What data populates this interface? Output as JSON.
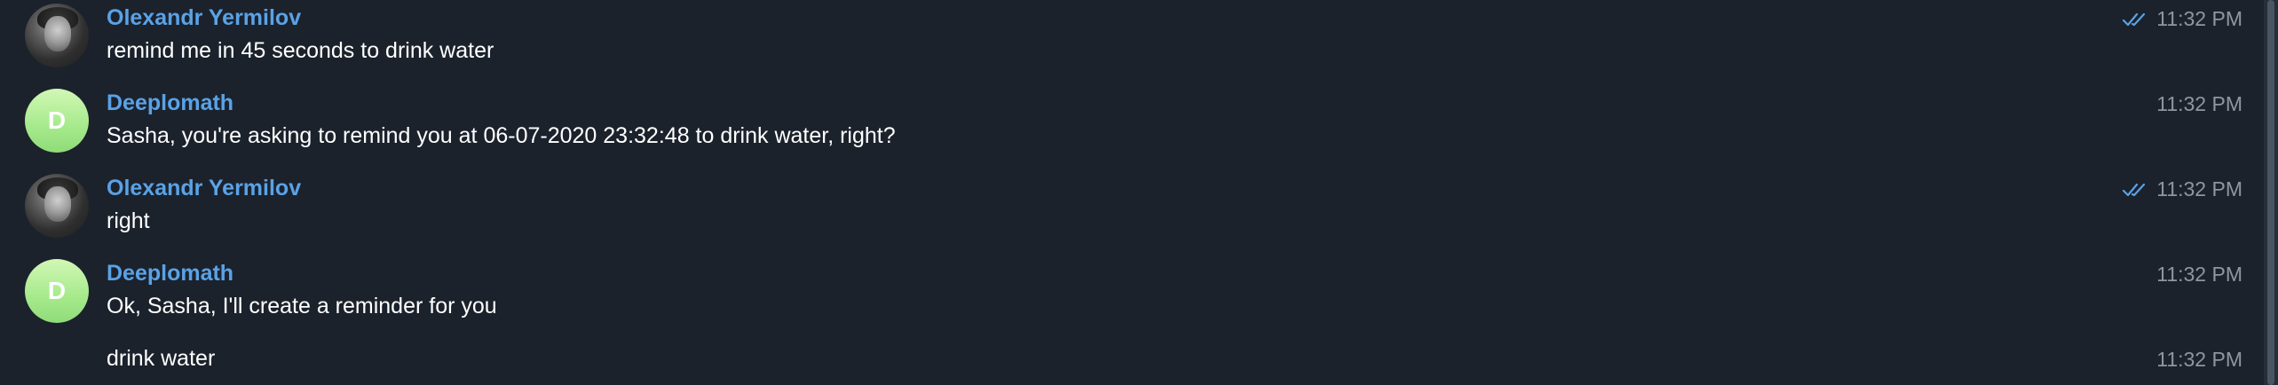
{
  "messages": [
    {
      "sender": "Olexandr Yermilov",
      "text": "remind me in 45 seconds to drink water",
      "time": "11:32 PM",
      "read": true,
      "avatar": "photo"
    },
    {
      "sender": "Deeplomath",
      "text": "Sasha, you're asking to remind you at 06-07-2020 23:32:48 to drink water, right?",
      "time": "11:32 PM",
      "read": false,
      "avatar": "D"
    },
    {
      "sender": "Olexandr Yermilov",
      "text": "right",
      "time": "11:32 PM",
      "read": true,
      "avatar": "photo"
    },
    {
      "sender": "Deeplomath",
      "text": "Ok, Sasha, I'll create a reminder for you",
      "time": "11:32 PM",
      "read": false,
      "avatar": "D"
    },
    {
      "sender": "",
      "text": "drink water",
      "time": "11:32 PM",
      "read": false,
      "avatar": ""
    }
  ],
  "colors": {
    "background": "#1b222c",
    "sender_name": "#5aa2e6",
    "message_text": "#ffffff",
    "timestamp": "#8e96a0",
    "read_check": "#5aa2e6",
    "bot_avatar": "#a9eb8e"
  },
  "icons": {
    "read_receipt": "double-check-icon"
  }
}
